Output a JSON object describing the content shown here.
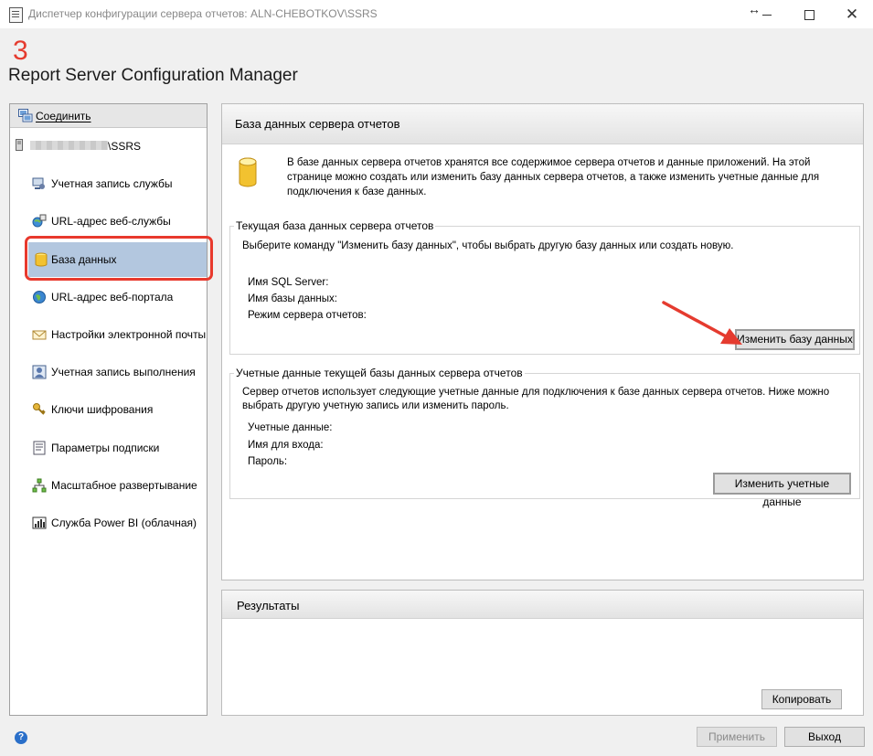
{
  "window": {
    "title": "Диспетчер конфигурации сервера отчетов: ALN-CHEBOTKOV\\SSRS",
    "icons": {
      "app": "report-icon",
      "resize": "resize-horizontal-icon",
      "minimize": "minimize-icon",
      "maximize": "maximize-icon",
      "close": "close-icon"
    }
  },
  "banner": {
    "step_number": "3",
    "title": "Report Server Configuration Manager"
  },
  "sidebar": {
    "connect_label": "Соединить",
    "server_suffix": "\\SSRS",
    "items": [
      {
        "label": "Учетная запись службы",
        "icon": "service-account-icon"
      },
      {
        "label": "URL-адрес веб-службы",
        "icon": "web-service-url-icon"
      },
      {
        "label": "База данных",
        "icon": "database-icon",
        "selected": true
      },
      {
        "label": "URL-адрес веб-портала",
        "icon": "globe-icon"
      },
      {
        "label": "Настройки электронной почты",
        "icon": "email-icon"
      },
      {
        "label": "Учетная запись выполнения",
        "icon": "execution-account-icon"
      },
      {
        "label": "Ключи шифрования",
        "icon": "key-icon"
      },
      {
        "label": "Параметры подписки",
        "icon": "subscription-icon"
      },
      {
        "label": "Масштабное развертывание",
        "icon": "scale-out-icon"
      },
      {
        "label": "Служба Power BI (облачная)",
        "icon": "power-bi-icon"
      }
    ]
  },
  "main": {
    "header": "База данных сервера отчетов",
    "description_line1": "В базе данных сервера отчетов хранятся все содержимое сервера отчетов и данные приложений. На этой",
    "description_line2": "странице можно создать или изменить базу данных сервера отчетов, а также изменить учетные данные для",
    "description_line3": "подключения к базе данных.",
    "current_db": {
      "title": "Текущая база данных сервера отчетов",
      "instruction": "Выберите команду \"Изменить базу данных\", чтобы выбрать другую базу данных или создать новую.",
      "sql_server_label": "Имя SQL Server:",
      "db_name_label": "Имя базы данных:",
      "mode_label": "Режим сервера отчетов:",
      "change_button": "Изменить базу данных"
    },
    "credentials": {
      "title": "Учетные данные текущей базы данных сервера отчетов",
      "desc_line1": "Сервер отчетов использует следующие учетные данные для подключения к базе данных сервера отчетов. Ниже можно",
      "desc_line2": "выбрать другую учетную запись или изменить пароль.",
      "credentials_label": "Учетные данные:",
      "login_label": "Имя для входа:",
      "password_label": "Пароль:",
      "change_button": "Изменить учетные данные"
    }
  },
  "results": {
    "title": "Результаты",
    "copy_button": "Копировать"
  },
  "footer": {
    "apply_button": "Применить",
    "exit_button": "Выход",
    "help_icon": "help-icon"
  },
  "colors": {
    "highlight": "#e8392d",
    "selected_bg": "#b3c7df",
    "arrow": "#e53b2f"
  }
}
